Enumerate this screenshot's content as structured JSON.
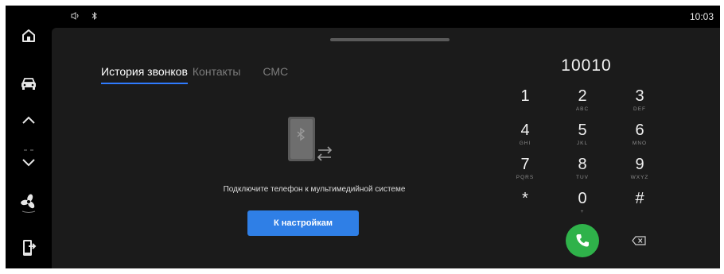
{
  "status": {
    "time": "10:03",
    "icons": [
      "volume-icon",
      "bluetooth-icon"
    ]
  },
  "sidebar": {
    "items": [
      "home-icon",
      "car-icon",
      "chevron-up-icon",
      "chevron-down-icon",
      "fan-icon",
      "phone-exit-icon"
    ]
  },
  "tabs": [
    {
      "label": "История звонков",
      "active": true
    },
    {
      "label": "Контакты",
      "active": false
    },
    {
      "label": "СМС",
      "active": false
    }
  ],
  "connect": {
    "message": "Подключите телефон к мультимедийной системе",
    "button_label": "К настройкам"
  },
  "dialer": {
    "number": "10010",
    "keys": [
      {
        "digit": "1",
        "letters": ""
      },
      {
        "digit": "2",
        "letters": "ABC"
      },
      {
        "digit": "3",
        "letters": "DEF"
      },
      {
        "digit": "4",
        "letters": "GHI"
      },
      {
        "digit": "5",
        "letters": "JKL"
      },
      {
        "digit": "6",
        "letters": "MNO"
      },
      {
        "digit": "7",
        "letters": "PQRS"
      },
      {
        "digit": "8",
        "letters": "TUV"
      },
      {
        "digit": "9",
        "letters": "WXYZ"
      },
      {
        "digit": "*",
        "letters": ""
      },
      {
        "digit": "0",
        "letters": "+"
      },
      {
        "digit": "#",
        "letters": ""
      }
    ]
  },
  "colors": {
    "accent": "#2f7fe6",
    "call": "#2fb24a",
    "background": "#1b1b1b"
  }
}
